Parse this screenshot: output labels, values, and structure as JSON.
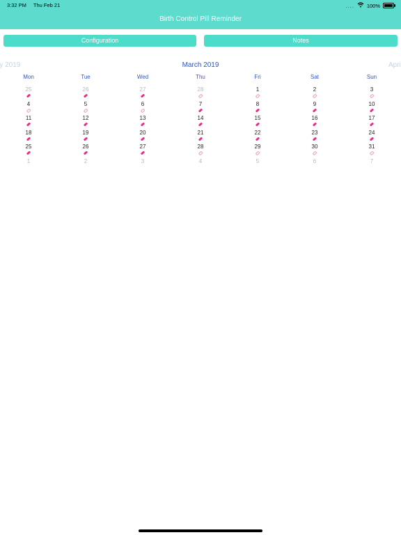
{
  "status": {
    "time": "3:32 PM",
    "date": "Thu Feb 21",
    "battery": "100%",
    "dots": "....",
    "wifi_icon": "wifi-icon",
    "battery_icon": "battery-icon"
  },
  "app": {
    "title": "Birth Control Pill Reminder",
    "accent": "#5ddcce",
    "button_color": "#4ddbca"
  },
  "buttons": {
    "configuration": "Configuration",
    "notes": "Notes"
  },
  "calendar": {
    "current_month": "March 2019",
    "prev_month": "ry 2019",
    "next_month": "April",
    "weekdays": [
      "Mon",
      "Tue",
      "Wed",
      "Thu",
      "Fri",
      "Sat",
      "Sun"
    ],
    "weeks": [
      [
        {
          "d": "25",
          "dim": true,
          "pill": "active"
        },
        {
          "d": "26",
          "dim": true,
          "pill": "active"
        },
        {
          "d": "27",
          "dim": true,
          "pill": "active"
        },
        {
          "d": "28",
          "dim": true,
          "pill": "inactive"
        },
        {
          "d": "1",
          "dim": false,
          "pill": "inactive"
        },
        {
          "d": "2",
          "dim": false,
          "pill": "inactive"
        },
        {
          "d": "3",
          "dim": false,
          "pill": "inactive"
        }
      ],
      [
        {
          "d": "4",
          "dim": false,
          "pill": "inactive"
        },
        {
          "d": "5",
          "dim": false,
          "pill": "inactive"
        },
        {
          "d": "6",
          "dim": false,
          "pill": "inactive"
        },
        {
          "d": "7",
          "dim": false,
          "pill": "active"
        },
        {
          "d": "8",
          "dim": false,
          "pill": "active"
        },
        {
          "d": "9",
          "dim": false,
          "pill": "active"
        },
        {
          "d": "10",
          "dim": false,
          "pill": "active"
        }
      ],
      [
        {
          "d": "11",
          "dim": false,
          "pill": "active"
        },
        {
          "d": "12",
          "dim": false,
          "pill": "active"
        },
        {
          "d": "13",
          "dim": false,
          "pill": "active"
        },
        {
          "d": "14",
          "dim": false,
          "pill": "active"
        },
        {
          "d": "15",
          "dim": false,
          "pill": "active"
        },
        {
          "d": "16",
          "dim": false,
          "pill": "active"
        },
        {
          "d": "17",
          "dim": false,
          "pill": "active"
        }
      ],
      [
        {
          "d": "18",
          "dim": false,
          "pill": "active"
        },
        {
          "d": "19",
          "dim": false,
          "pill": "active"
        },
        {
          "d": "20",
          "dim": false,
          "pill": "active"
        },
        {
          "d": "21",
          "dim": false,
          "pill": "active"
        },
        {
          "d": "22",
          "dim": false,
          "pill": "active"
        },
        {
          "d": "23",
          "dim": false,
          "pill": "active"
        },
        {
          "d": "24",
          "dim": false,
          "pill": "active"
        }
      ],
      [
        {
          "d": "25",
          "dim": false,
          "pill": "active"
        },
        {
          "d": "26",
          "dim": false,
          "pill": "active"
        },
        {
          "d": "27",
          "dim": false,
          "pill": "active"
        },
        {
          "d": "28",
          "dim": false,
          "pill": "inactive"
        },
        {
          "d": "29",
          "dim": false,
          "pill": "inactive"
        },
        {
          "d": "30",
          "dim": false,
          "pill": "inactive"
        },
        {
          "d": "31",
          "dim": false,
          "pill": "inactive"
        }
      ],
      [
        {
          "d": "1",
          "dim": true,
          "pill": "none"
        },
        {
          "d": "2",
          "dim": true,
          "pill": "none"
        },
        {
          "d": "3",
          "dim": true,
          "pill": "none"
        },
        {
          "d": "4",
          "dim": true,
          "pill": "none"
        },
        {
          "d": "5",
          "dim": true,
          "pill": "none"
        },
        {
          "d": "6",
          "dim": true,
          "pill": "none"
        },
        {
          "d": "7",
          "dim": true,
          "pill": "none"
        }
      ]
    ]
  }
}
